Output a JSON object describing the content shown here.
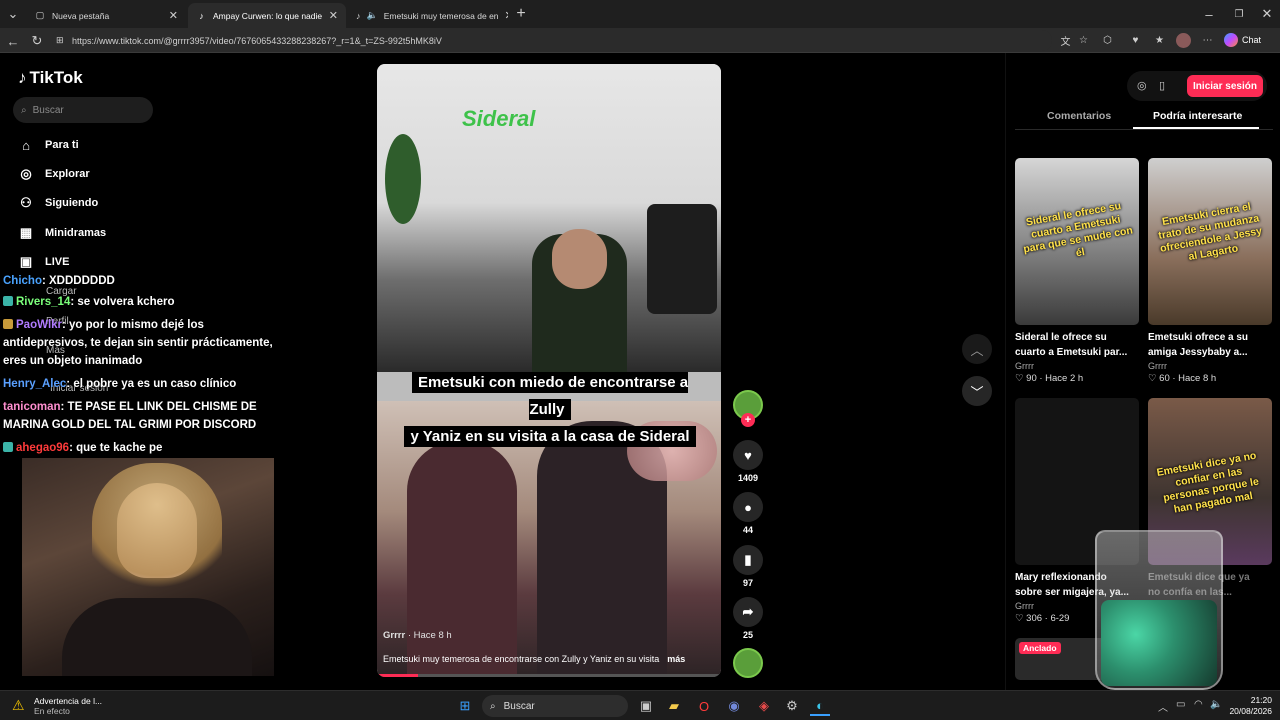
{
  "browser": {
    "tabs": [
      {
        "label": "Nueva pestaña",
        "icon": "page-icon"
      },
      {
        "label": "Ampay Curwen: lo que nadie vio d",
        "icon": "tiktok-icon",
        "active": true
      },
      {
        "label": "Emetsuki muy temerosa de en",
        "icon": "tiktok-icon"
      }
    ],
    "url": "https://www.tiktok.com/@grrrr3957/video/7676065433288238267?_r=1&_t=ZS-992t5hMK8iV",
    "chat_label": "Chat"
  },
  "sidebar": {
    "logo": "TikTok",
    "search_placeholder": "Buscar",
    "items": [
      {
        "label": "Para ti",
        "icon": "home-icon"
      },
      {
        "label": "Explorar",
        "icon": "compass-icon"
      },
      {
        "label": "Siguiendo",
        "icon": "following-icon"
      },
      {
        "label": "Minidramas",
        "icon": "film-icon"
      },
      {
        "label": "LIVE",
        "icon": "live-icon"
      }
    ],
    "ghost_items": [
      "Cargar",
      "Perfil",
      "Más",
      "Iniciar sesión"
    ]
  },
  "chat_overlay": [
    {
      "user": "Chicho",
      "text": ": XDDDDDDD",
      "color": "#4aa3ff"
    },
    {
      "user": "Rivers_14",
      "text": ": se volvera kchero",
      "color": "#7bff7b"
    },
    {
      "user": "PaoWlkr",
      "text": ": yo por lo mismo dejé los antidepresivos, te dejan sin sentir prácticamente, eres un objeto inanimado",
      "color": "#b07bff"
    },
    {
      "user": "Henry_Alec",
      "text": ": el pobre ya es un caso clínico",
      "color": "#5aa0ff"
    },
    {
      "user": "tanicoman",
      "text": ": TE PASE EL LINK DEL CHISME DE MARINA GOLD DEL TAL GRIMI POR DISCORD",
      "color": "#ff8fd0"
    },
    {
      "user": "ahegao96",
      "text": ": que te kache pe",
      "color": "#ff3b3b"
    }
  ],
  "video": {
    "sign_text": "Sideral",
    "caption_line1": "Emetsuki con miedo de encontrarse a Zully",
    "caption_line2": "y Yaniz en su visita a la casa de Sideral",
    "author": "Grrrr",
    "posted": "Hace 8 h",
    "author_meta": "Grrrr · Hace 8 h",
    "description": "Emetsuki muy temerosa de encontrarse con Zully y Yaniz en su visita",
    "more_label": "más",
    "progress": 0.12
  },
  "actions": {
    "likes": "1409",
    "comments": "44",
    "saves": "97",
    "shares": "25"
  },
  "right_panel": {
    "login_label": "Iniciar sesión",
    "tabs": [
      "Comentarios",
      "Podría interesarte"
    ],
    "cards": [
      {
        "overlay": "Sideral le ofrece su cuarto a Emetsuki para que se mude con él",
        "title": "Sideral le ofrece su cuarto a Emetsuki par...",
        "author": "Grrrr",
        "stats": "♡ 90 · Hace 2 h"
      },
      {
        "overlay": "Emetsuki cierra el trato de su mudanza ofreciendole a Jessy al Lagarto",
        "title": "Emetsuki ofrece a su amiga Jessybaby a...",
        "author": "Grrrr",
        "stats": "♡ 60 · Hace 8 h"
      },
      {
        "overlay": "",
        "title": "Mary reflexionando sobre ser migajera, ya...",
        "author": "Grrrr",
        "stats": "♡ 306 · 6-29"
      },
      {
        "overlay": "Emetsuki dice ya no confiar en las personas porque le han pagado mal",
        "title": "Emetsuki dice que ya no confía en las...",
        "author": "",
        "stats": ""
      }
    ],
    "pinned_label": "Anclado"
  },
  "taskbar": {
    "warning_title": "Advertencia de l...",
    "warning_sub": "En efecto",
    "search_label": "Buscar",
    "time": "21:20",
    "date": "20/08/2026"
  }
}
